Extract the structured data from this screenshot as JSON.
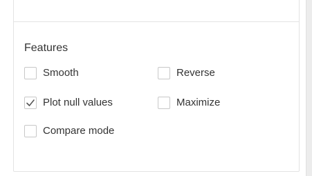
{
  "features": {
    "title": "Features",
    "options": [
      {
        "id": "smooth",
        "label": "Smooth",
        "checked": false
      },
      {
        "id": "reverse",
        "label": "Reverse",
        "checked": false
      },
      {
        "id": "plotnull",
        "label": "Plot null values",
        "checked": true
      },
      {
        "id": "maximize",
        "label": "Maximize",
        "checked": false
      },
      {
        "id": "compare",
        "label": "Compare mode",
        "checked": false
      }
    ]
  },
  "colors": {
    "border": "#e3e3e3",
    "checkbox_border": "#c8c8c8",
    "checkmark": "#555555",
    "text": "#333333",
    "scrollbar": "#ececec"
  },
  "icons": {
    "checked": "check-icon"
  }
}
